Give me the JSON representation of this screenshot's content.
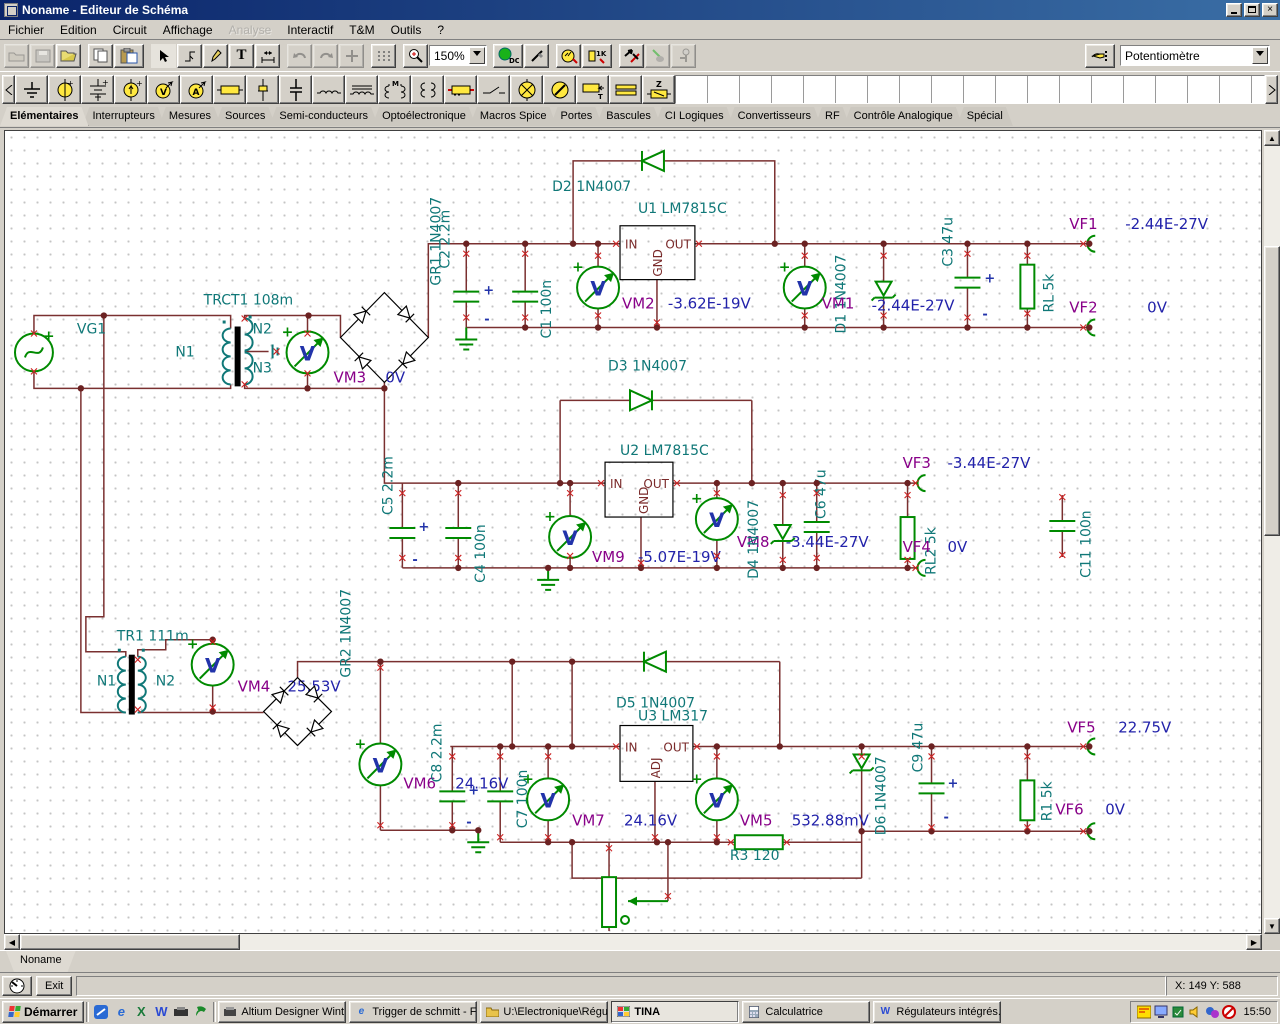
{
  "window": {
    "title": "Noname - Editeur de Schéma",
    "close": "×"
  },
  "menu": [
    "Fichier",
    "Edition",
    "Circuit",
    "Affichage",
    "Analyse",
    "Interactif",
    "T&M",
    "Outils",
    "?"
  ],
  "toolbar": {
    "zoom": "150%",
    "component": "Potentiomètre",
    "dc": "DC",
    "k1": "1K"
  },
  "icon_letters": {
    "v": "V",
    "a": "A",
    "m": "M",
    "t": "T",
    "z": "Z"
  },
  "tabs": [
    "Elémentaires",
    "Interrupteurs",
    "Mesures",
    "Sources",
    "Semi-conducteurs",
    "Optoélectronique",
    "Macros Spice",
    "Portes",
    "Bascules",
    "CI Logiques",
    "Convertisseurs",
    "RF",
    "Contrôle Analogique",
    "Spécial"
  ],
  "doc_tab": "Noname",
  "status": {
    "exit": "Exit",
    "coords": "X: 149 Y: 588"
  },
  "taskbar": {
    "start": "Démarrer",
    "tasks": [
      "Altium Designer Wint...",
      "Trigger de schmitt - F...",
      "U:\\Electronique\\Régu...",
      "TINA",
      "Calculatrice",
      "Régulateurs intégrés..."
    ],
    "clock": "15:50"
  },
  "schematic": {
    "meter_letter": "V",
    "plus": "+",
    "minus": "-",
    "vg1": "VG1",
    "trct1": "TRCT1 108m",
    "tr1": "TR1 111m",
    "n1": "N1",
    "n2": "N2",
    "n3": "N3",
    "gr1": "GR1 1N4007",
    "gr2": "GR2 1N4007",
    "c1": "C1 100n",
    "c2": "C2 2.2m",
    "c3": "C3 47u",
    "c4": "C4 100n",
    "c5": "C5 2.2m",
    "c6": "C6 47u",
    "c7": "C7 100n",
    "c8": "C8 2.2m",
    "c9": "C9 47u",
    "c11": "C11 100n",
    "d1": "D1 1N4007",
    "d2": "D2 1N4007",
    "d3": "D3 1N4007",
    "d4": "D4 1N4007",
    "d5": "D5 1N4007",
    "d6": "D6 1N4007",
    "u1": "U1 LM7815C",
    "u2": "U2 LM7815C",
    "u3": "U3 LM317",
    "rl": "RL 5k",
    "rl2": "RL2 5k",
    "r1": "R1 5k",
    "r3": "R3 120",
    "pin_in": "IN",
    "pin_out": "OUT",
    "pin_gnd": "GND",
    "pin_adj": "ADJ",
    "vm1": "VM1",
    "vm1_v": "-2.44E-27V",
    "vm2": "VM2",
    "vm2_v": "-3.62E-19V",
    "vm3": "VM3",
    "vm3_v": "0V",
    "vm4": "VM4",
    "vm4_v": "25.53V",
    "vm5": "VM5",
    "vm5_v": "532.88mV",
    "vm6": "VM6",
    "vm6_v": "24.16V",
    "vm7": "VM7",
    "vm7_v": "24.16V",
    "vm8": "VM8",
    "vm8_v": "-3.44E-27V",
    "vm9": "VM9",
    "vm9_v": "-5.07E-19V",
    "vf1": "VF1",
    "vf1_v": "-2.44E-27V",
    "vf2": "VF2",
    "vf2_v": "0V",
    "vf3": "VF3",
    "vf3_v": "-3.44E-27V",
    "vf4": "VF4",
    "vf4_v": "0V",
    "vf5": "VF5",
    "vf5_v": "22.75V",
    "vf6": "VF6",
    "vf6_v": "0V"
  }
}
